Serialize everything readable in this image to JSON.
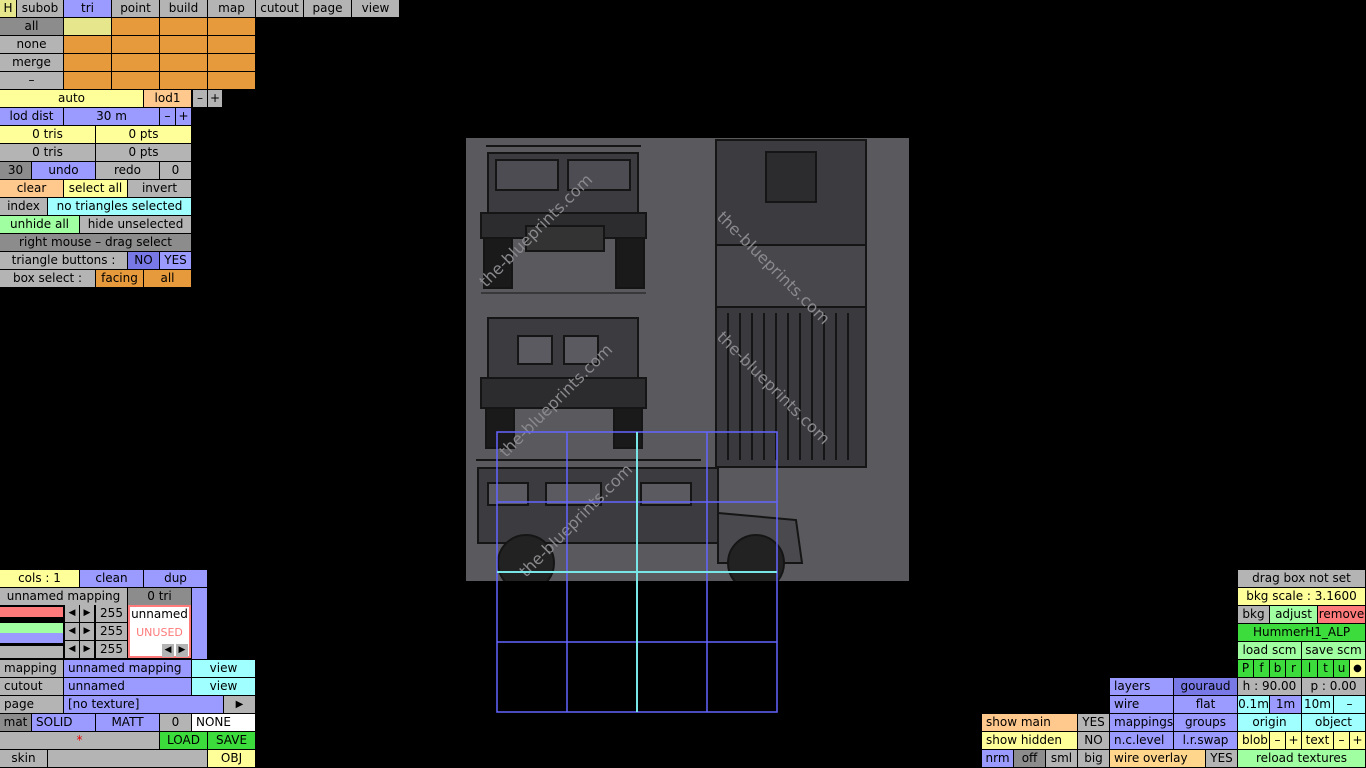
{
  "top_tabs": [
    "H",
    "subob",
    "tri",
    "point",
    "build",
    "map",
    "cutout",
    "page",
    "view"
  ],
  "select_rows": [
    "all",
    "none",
    "merge",
    "–"
  ],
  "lod": {
    "auto": "auto",
    "level": "lod1",
    "minus": "–",
    "plus": "+",
    "dist_label": "lod dist",
    "dist_value": "30 m"
  },
  "stats": {
    "tris1": "0 tris",
    "pts1": "0 pts",
    "tris2": "0 tris",
    "pts2": "0 pts"
  },
  "history": {
    "count": "30",
    "undo": "undo",
    "redo": "redo",
    "zero": "0"
  },
  "select": {
    "clear": "clear",
    "select_all": "select all",
    "invert": "invert",
    "index": "index",
    "status": "no triangles selected",
    "unhide_all": "unhide all",
    "hide_unselected": "hide unselected",
    "right_mouse": "right mouse – drag select",
    "tri_buttons": "triangle buttons :",
    "no": "NO",
    "yes": "YES",
    "box_select": "box select :",
    "facing": "facing",
    "all": "all"
  },
  "mapping_panel": {
    "cols": "cols : 1",
    "clean": "clean",
    "dup": "dup",
    "mapping_name": "unnamed mapping",
    "tri_count": "0 tri",
    "v1": "255",
    "v2": "255",
    "v3": "255",
    "mat_name": "unnamed",
    "unused": "UNUSED",
    "left": "◀",
    "right": "▶",
    "mapping_label": "mapping",
    "mapping_value": "unnamed mapping",
    "view": "view",
    "cutout_label": "cutout",
    "cutout_value": "unnamed",
    "page_label": "page",
    "page_value": "[no texture]",
    "play": "▶",
    "mat": "mat",
    "solid": "SOLID",
    "matt": "MATT",
    "zero": "0",
    "none": "NONE",
    "star": "*",
    "load": "LOAD",
    "save": "SAVE",
    "skin": "skin",
    "obj": "OBJ"
  },
  "right_panel": {
    "drag_box": "drag box not set",
    "bkg_scale": "bkg scale : 3.1600",
    "bkg": "bkg",
    "adjust": "adjust",
    "remove": "remove",
    "file": "HummerH1_ALP",
    "load_scm": "load scm",
    "save_scm": "save scm",
    "views": [
      "P",
      "f",
      "b",
      "r",
      "l",
      "t",
      "u",
      "●"
    ],
    "layers": "layers",
    "gouraud": "gouraud",
    "h": "h : 90.00",
    "p": "p : 0.00",
    "wire": "wire",
    "flat": "flat",
    "g1": "0.1m",
    "g2": "1m",
    "g3": "10m",
    "gminus": "–",
    "show_main": "show main",
    "show_main_v": "YES",
    "mappings": "mappings",
    "groups": "groups",
    "origin": "origin",
    "object": "object",
    "show_hidden": "show hidden",
    "show_hidden_v": "NO",
    "nclevel": "n.c.level",
    "lrswap": "l.r.swap",
    "blob": "blob",
    "text": "text",
    "nrm": "nrm",
    "off": "off",
    "sml": "sml",
    "big": "big",
    "wire_overlay": "wire overlay",
    "wire_overlay_v": "YES",
    "reload": "reload textures"
  },
  "watermark": "the-blueprints.com"
}
